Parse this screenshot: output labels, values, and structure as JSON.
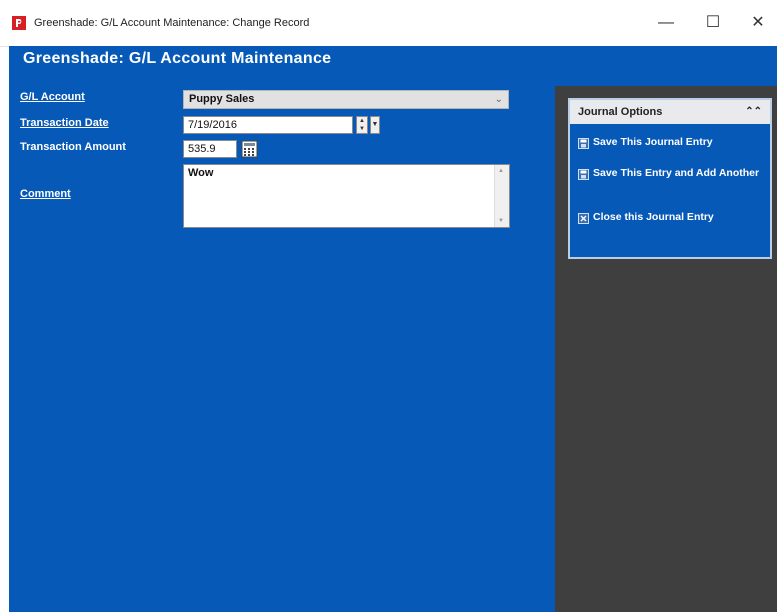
{
  "window": {
    "title": "Greenshade: G/L Account Maintenance: Change Record",
    "minimize_glyph": "—",
    "maximize_glyph": "☐",
    "close_glyph": "✕"
  },
  "app": {
    "header": "Greenshade: G/L Account Maintenance"
  },
  "form": {
    "gl_account_label": "G/L Account",
    "gl_account_value": "Puppy Sales",
    "transaction_date_label": "Transaction Date",
    "transaction_date_value": "7/19/2016",
    "transaction_amount_label": "Transaction Amount",
    "transaction_amount_value": "535.9",
    "comment_label": "Comment",
    "comment_value": "Wow"
  },
  "journal_options": {
    "title": "Journal Options",
    "items": [
      {
        "label": "Save This Journal Entry",
        "icon": "save-icon"
      },
      {
        "label": "Save This Entry and Add Another",
        "icon": "save-add-icon"
      },
      {
        "label": "Close this Journal Entry",
        "icon": "close-entry-icon"
      }
    ]
  },
  "colors": {
    "client_blue": "#0759b8",
    "side_panel": "#3f3f3f",
    "app_icon_red": "#d81f26"
  }
}
